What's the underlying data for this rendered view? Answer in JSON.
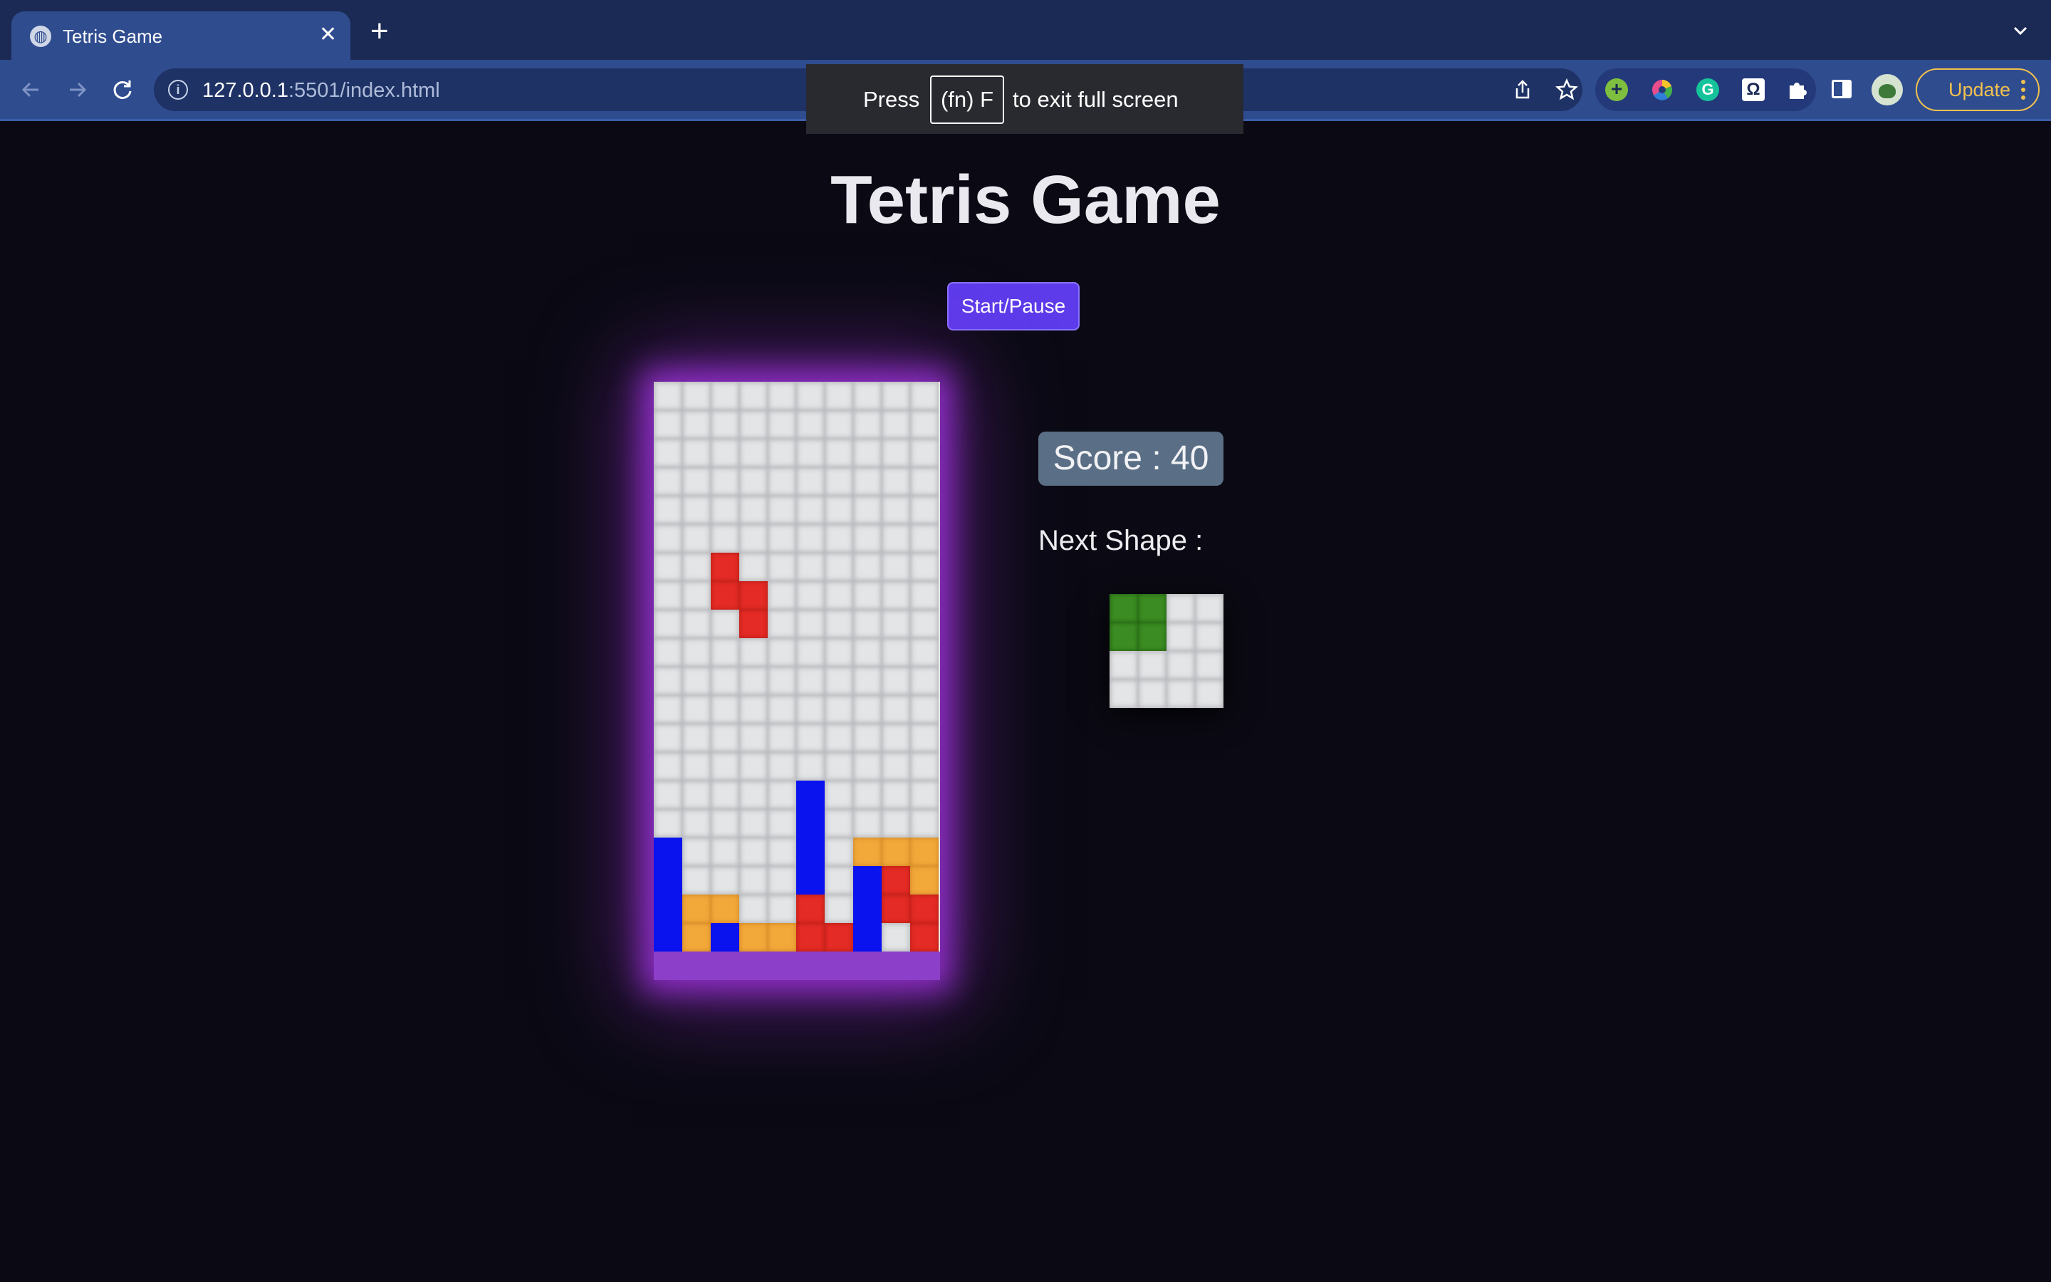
{
  "browser": {
    "tab": {
      "title": "Tetris Game",
      "favicon": "globe-icon",
      "close": "✕"
    },
    "new_tab": "+",
    "url_host": "127.0.0.1",
    "url_rest": ":5501/index.html",
    "update_label": "Update",
    "extensions": [
      "add-extension-icon",
      "color-wheel-icon",
      "grammarly-icon",
      "omega-icon",
      "puzzle-icon"
    ]
  },
  "fullscreen_notice": {
    "press": "Press",
    "key": "(fn) F",
    "rest": "to exit full screen"
  },
  "game": {
    "title": "Tetris Game",
    "start_button": "Start/Pause",
    "score_text": "Score : 40",
    "next_label": "Next Shape :",
    "colors": {
      "blue": "#0a12ee",
      "red": "#e52b25",
      "orange": "#f3a83a",
      "green": "#3b8c22",
      "empty": "#e4e5e6",
      "glow": "#8e2ec6"
    },
    "board": {
      "columns": 10,
      "rows": 20,
      "cells": [
        {
          "row": 6,
          "col": 2,
          "color": "red"
        },
        {
          "row": 7,
          "col": 2,
          "color": "red"
        },
        {
          "row": 7,
          "col": 3,
          "color": "red"
        },
        {
          "row": 8,
          "col": 3,
          "color": "red"
        },
        {
          "row": 14,
          "col": 5,
          "color": "blue"
        },
        {
          "row": 15,
          "col": 5,
          "color": "blue"
        },
        {
          "row": 16,
          "col": 5,
          "color": "blue"
        },
        {
          "row": 17,
          "col": 5,
          "color": "blue"
        },
        {
          "row": 16,
          "col": 0,
          "color": "blue"
        },
        {
          "row": 17,
          "col": 0,
          "color": "blue"
        },
        {
          "row": 18,
          "col": 0,
          "color": "blue"
        },
        {
          "row": 19,
          "col": 0,
          "color": "blue"
        },
        {
          "row": 16,
          "col": 7,
          "color": "orange"
        },
        {
          "row": 16,
          "col": 8,
          "color": "orange"
        },
        {
          "row": 16,
          "col": 9,
          "color": "orange"
        },
        {
          "row": 17,
          "col": 9,
          "color": "orange"
        },
        {
          "row": 17,
          "col": 7,
          "color": "blue"
        },
        {
          "row": 18,
          "col": 7,
          "color": "blue"
        },
        {
          "row": 19,
          "col": 7,
          "color": "blue"
        },
        {
          "row": 17,
          "col": 8,
          "color": "red"
        },
        {
          "row": 18,
          "col": 8,
          "color": "red"
        },
        {
          "row": 18,
          "col": 9,
          "color": "red"
        },
        {
          "row": 19,
          "col": 9,
          "color": "red"
        },
        {
          "row": 18,
          "col": 1,
          "color": "orange"
        },
        {
          "row": 18,
          "col": 2,
          "color": "orange"
        },
        {
          "row": 19,
          "col": 1,
          "color": "orange"
        },
        {
          "row": 19,
          "col": 2,
          "color": "blue"
        },
        {
          "row": 19,
          "col": 3,
          "color": "orange"
        },
        {
          "row": 19,
          "col": 4,
          "color": "orange"
        },
        {
          "row": 18,
          "col": 5,
          "color": "red"
        },
        {
          "row": 19,
          "col": 5,
          "color": "red"
        },
        {
          "row": 19,
          "col": 6,
          "color": "red"
        }
      ]
    },
    "next_shape": {
      "columns": 4,
      "rows": 4,
      "cells": [
        {
          "row": 0,
          "col": 0,
          "color": "green"
        },
        {
          "row": 0,
          "col": 1,
          "color": "green"
        },
        {
          "row": 1,
          "col": 0,
          "color": "green"
        },
        {
          "row": 1,
          "col": 1,
          "color": "green"
        }
      ]
    }
  }
}
